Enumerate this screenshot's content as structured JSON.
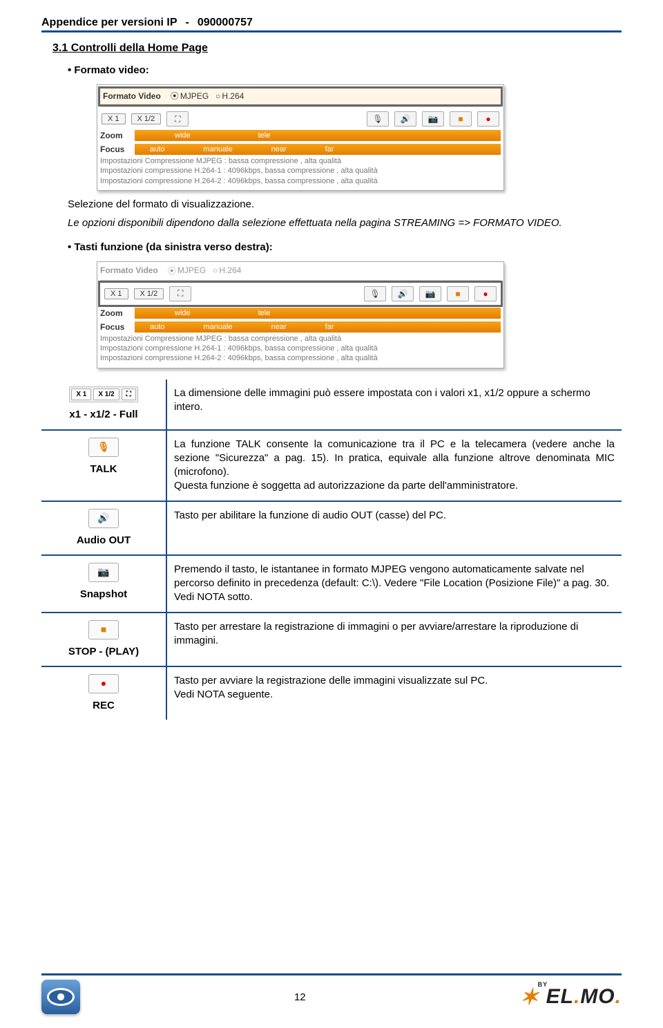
{
  "header": {
    "title": "Appendice per versioni IP",
    "sep": "-",
    "doc_number": "090000757"
  },
  "section": {
    "number_title": "3.1 Controlli della Home Page",
    "bullet1": "Formato video:",
    "bullet2": "Tasti funzione (da sinistra verso destra):"
  },
  "para1": "Selezione del formato di visualizzazione.",
  "para2": "Le opzioni disponibili dipendono dalla selezione effettuata nella pagina STREAMING => FORMATO VIDEO.",
  "shot": {
    "format_label": "Formato Video",
    "radio1": "MJPEG",
    "radio2": "H.264",
    "btn_x1": "X 1",
    "btn_x12": "X 1/2",
    "btn_full": "⛶",
    "ico_mic": "🎙",
    "ico_spk": "🔊",
    "ico_cam": "📷",
    "ico_stop": "■",
    "ico_rec": "●",
    "zoom_label": "Zoom",
    "zoom_wide": "wide",
    "zoom_tele": "tele",
    "focus_label": "Focus",
    "focus_auto": "auto",
    "focus_manual": "manuale",
    "focus_near": "near",
    "focus_far": "far",
    "comp1": "Impostazioni Compressione MJPEG : bassa compressione , alta qualità",
    "comp2": "Impostazioni compressione H.264-1 : 4096kbps, bassa compressione , alta qualità",
    "comp3": "Impostazioni compressione H.264-2 : 4096kbps, bassa compressione , alta qualità"
  },
  "table": {
    "row0": {
      "label": "x1 - x1/2 - Full",
      "desc": "La dimensione delle immagini può essere impostata con i valori x1, x1/2 oppure a schermo intero."
    },
    "row1": {
      "label": "TALK",
      "desc": "La funzione TALK consente la comunicazione tra il PC e la telecamera (vedere anche la sezione \"Sicurezza\" a pag. 15). In pratica, equivale alla funzione altrove denominata MIC (microfono).\nQuesta funzione è soggetta ad autorizzazione da parte dell'amministratore."
    },
    "row2": {
      "label": "Audio OUT",
      "desc": "Tasto per abilitare la funzione di audio OUT (casse) del PC."
    },
    "row3": {
      "label": "Snapshot",
      "desc": "Premendo il tasto, le istantanee in formato MJPEG vengono automaticamente salvate nel percorso definito in precedenza (default: C:\\). Vedere \"File Location (Posizione File)\" a pag. 30.\nVedi NOTA sotto."
    },
    "row4": {
      "label": "STOP - (PLAY)",
      "desc": "Tasto per arrestare la registrazione di immagini o per avviare/arrestare la riproduzione di immagini."
    },
    "row5": {
      "label": "REC",
      "desc": "Tasto per avviare la registrazione delle immagini visualizzate sul PC.\nVedi NOTA seguente."
    }
  },
  "footer": {
    "page_no": "12",
    "logo_text": "EL.MO."
  }
}
